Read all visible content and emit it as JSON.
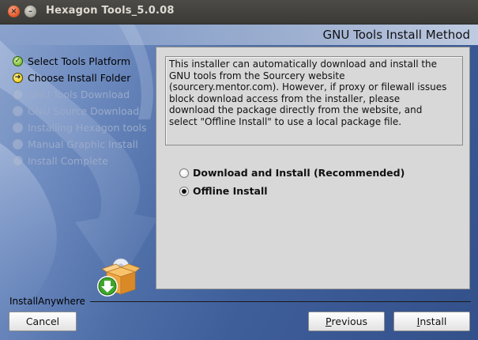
{
  "window": {
    "title": "Hexagon Tools_5.0.08",
    "close_glyph": "×",
    "minimize_glyph": "–"
  },
  "header": {
    "title": "GNU Tools Install Method"
  },
  "steps": [
    {
      "label": "Select Tools Platform",
      "state": "done",
      "glyph": "✓"
    },
    {
      "label": "Choose Install Folder",
      "state": "current",
      "glyph": "➔"
    },
    {
      "label": "GNU Tools Download",
      "state": "todo",
      "glyph": ""
    },
    {
      "label": "GNU Source Download",
      "state": "todo",
      "glyph": ""
    },
    {
      "label": "Installing Hexagon tools",
      "state": "todo",
      "glyph": ""
    },
    {
      "label": "Manual Graphic Install",
      "state": "todo",
      "glyph": ""
    },
    {
      "label": "Install Complete",
      "state": "todo",
      "glyph": ""
    }
  ],
  "info": {
    "lines": [
      "This installer can automatically download and install the",
      "GNU tools from the Sourcery website",
      "(sourcery.mentor.com). However, if proxy or filewall issues",
      "block download access from the installer,  please",
      "download the package directly from the website, and",
      "select \"Offline Install\" to use a local package file."
    ]
  },
  "options": {
    "download": {
      "label": "Download and Install (Recommended)",
      "selected": false
    },
    "offline": {
      "label": "Offline Install",
      "selected": true
    }
  },
  "footer": {
    "brand": "InstallAnywhere",
    "cancel_label": "Cancel",
    "previous_mnemonic": "P",
    "previous_rest": "revious",
    "install_mnemonic": "I",
    "install_rest": "nstall"
  },
  "colors": {
    "background_blue": "#4a6da8",
    "panel_gray": "#d8d8d8",
    "done_green": "#7bbf33",
    "current_yellow": "#f1d21d",
    "todo_text": "#9aabc9"
  },
  "icons": {
    "step_done": "check-icon",
    "step_current": "arrow-right-icon",
    "installer": "installer-box-download-icon"
  }
}
